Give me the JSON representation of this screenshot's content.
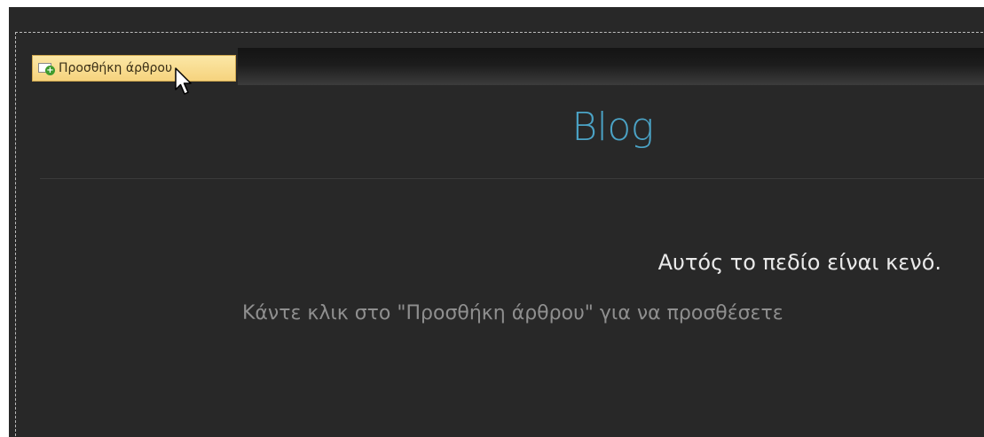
{
  "toolbar": {
    "add_article_label": "Προσθήκη άρθρου",
    "add_article_icon": "document-add-icon"
  },
  "blog": {
    "title": "Blog"
  },
  "empty_state": {
    "title": "Αυτός το πεδίο είναι κενό.",
    "hint": "Κάντε κλικ στο \"Προσθήκη άρθρου\" για να προσθέσετε"
  },
  "colors": {
    "background": "#282828",
    "title_accent": "#4ba3c6",
    "button_fill": "#f6d37e"
  }
}
